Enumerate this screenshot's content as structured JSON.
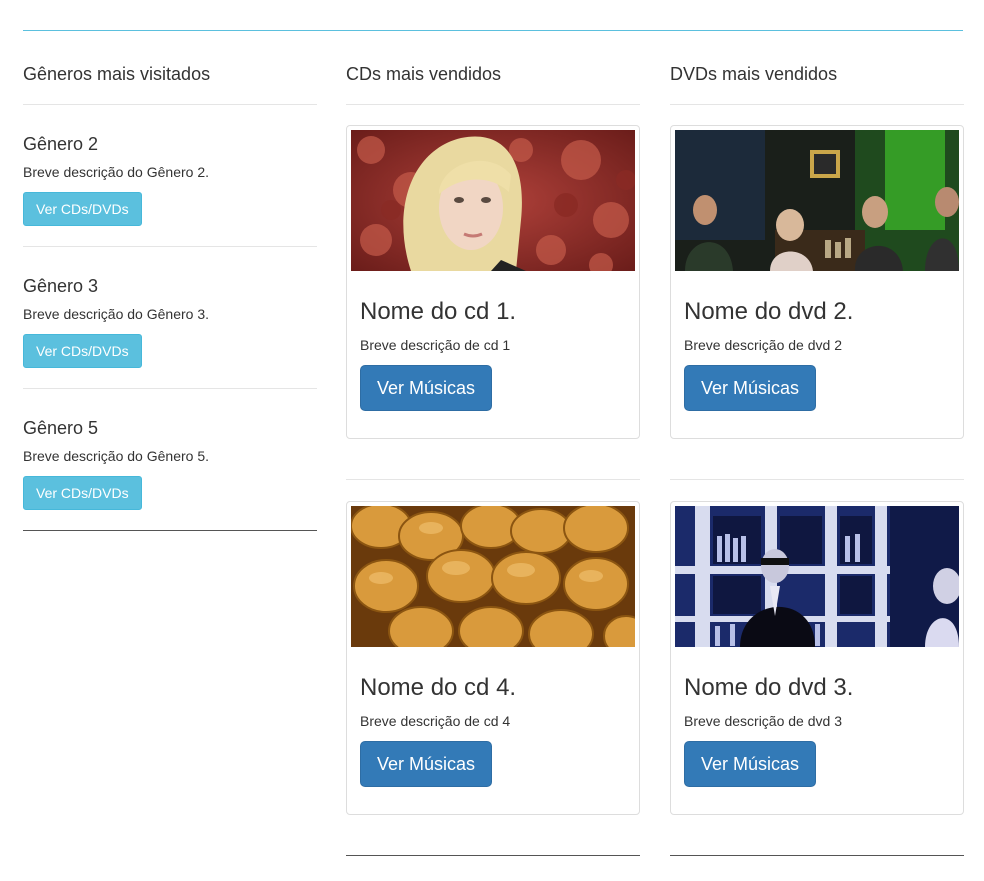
{
  "genres_section": {
    "title": "Gêneros mais visitados",
    "items": [
      {
        "name": "Gênero 2",
        "description": "Breve descrição do Gênero 2.",
        "button": "Ver CDs/DVDs"
      },
      {
        "name": "Gênero 3",
        "description": "Breve descrição do Gênero 3.",
        "button": "Ver CDs/DVDs"
      },
      {
        "name": "Gênero 5",
        "description": "Breve descrição do Gênero 5.",
        "button": "Ver CDs/DVDs"
      }
    ]
  },
  "cds_section": {
    "title": "CDs mais vendidos",
    "items": [
      {
        "name": "Nome do cd 1.",
        "description": "Breve descrição de cd 1",
        "button": "Ver Músicas",
        "image": "blonde-woman-photo"
      },
      {
        "name": "Nome do cd 4.",
        "description": "Breve descrição de cd 4",
        "button": "Ver Músicas",
        "image": "bread-rolls-photo"
      }
    ]
  },
  "dvds_section": {
    "title": "DVDs mais vendidos",
    "items": [
      {
        "name": "Nome do dvd 2.",
        "description": "Breve descrição de dvd 2",
        "button": "Ver Músicas",
        "image": "bar-people-photo"
      },
      {
        "name": "Nome do dvd 3.",
        "description": "Breve descrição de dvd 3",
        "button": "Ver Músicas",
        "image": "bartender-photo"
      }
    ]
  },
  "colors": {
    "info_button": "#5bc0de",
    "primary_button": "#337ab7",
    "accent_rule": "#5bc0de"
  }
}
